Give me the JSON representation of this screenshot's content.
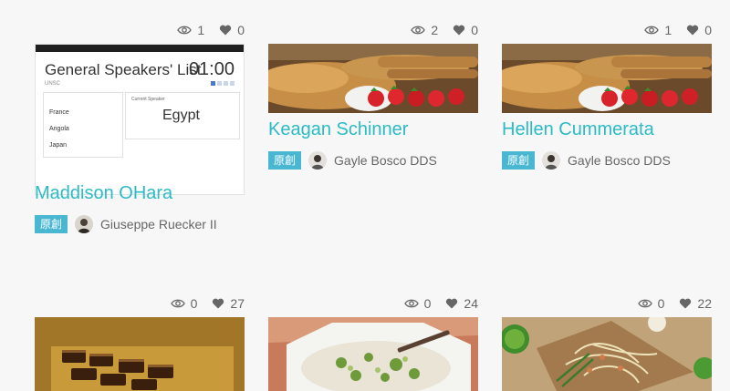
{
  "cards": [
    {
      "views": "1",
      "likes": "0",
      "title": "Maddison OHara",
      "badge": "原創",
      "author": "Giuseppe Ruecker II",
      "thumbnail": {
        "kind": "app-screenshot",
        "heading": "General Speakers' List",
        "sub": "UNSC",
        "timer": "01:00",
        "countries": [
          "France",
          "Angola",
          "Japan"
        ],
        "current_label": "Current Speaker",
        "speaker": "Egypt"
      }
    },
    {
      "views": "2",
      "likes": "0",
      "title": "Keagan Schinner",
      "badge": "原創",
      "author": "Gayle Bosco DDS",
      "thumbnail": {
        "kind": "photo-pancakes"
      }
    },
    {
      "views": "1",
      "likes": "0",
      "title": "Hellen Cummerata",
      "badge": "原創",
      "author": "Gayle Bosco DDS",
      "thumbnail": {
        "kind": "photo-pancakes"
      }
    },
    {
      "views": "0",
      "likes": "27",
      "thumbnail": {
        "kind": "photo-chocolate-bars"
      }
    },
    {
      "views": "0",
      "likes": "24",
      "thumbnail": {
        "kind": "photo-rice-salad"
      }
    },
    {
      "views": "0",
      "likes": "22",
      "thumbnail": {
        "kind": "photo-noodles"
      }
    }
  ],
  "colors": {
    "title": "#2bbbc4",
    "badge": "#4ab7d2",
    "background": "#f7f7f7"
  }
}
